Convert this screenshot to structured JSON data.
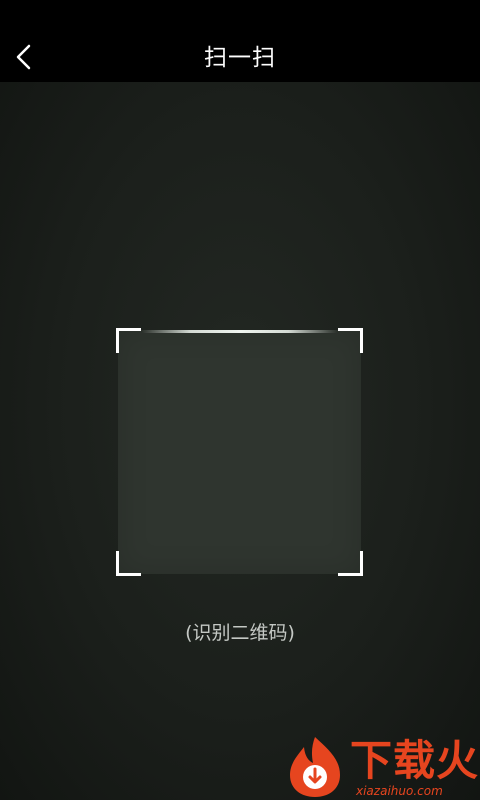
{
  "header": {
    "back_icon": "chevron-left-icon",
    "title": "扫一扫"
  },
  "scanner": {
    "hint": "(识别二维码)"
  },
  "watermark": {
    "brand": "下载火",
    "url": "xiazaihuo.com",
    "logo_icon": "download-flame-logo-icon"
  },
  "colors": {
    "header_bg": "#000000",
    "camera_bg": "#1b1f1b",
    "scan_area": "#2f352f",
    "frame_corner": "#ffffff",
    "hint_text": "#c4c8c4",
    "watermark": "#e6451f"
  }
}
